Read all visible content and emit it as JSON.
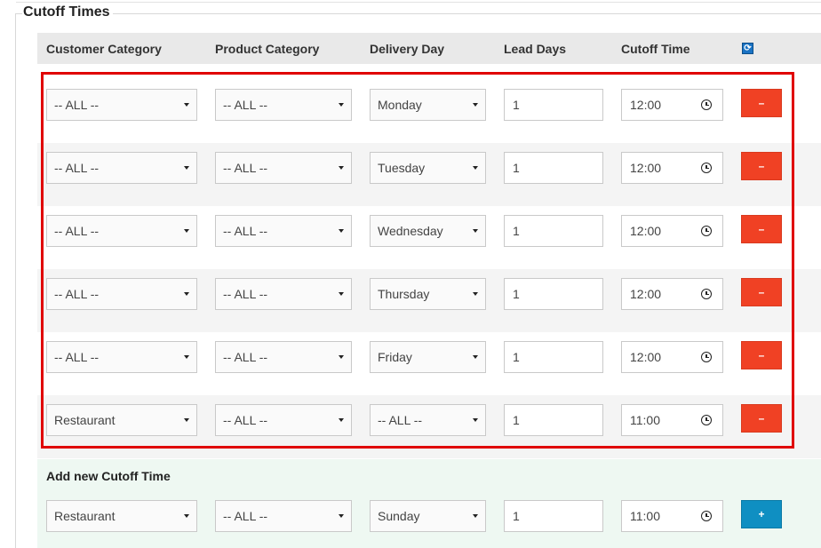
{
  "legend": "Cutoff Times",
  "headers": {
    "customer_category": "Customer Category",
    "product_category": "Product Category",
    "delivery_day": "Delivery Day",
    "lead_days": "Lead Days",
    "cutoff_time": "Cutoff Time"
  },
  "refresh_icon": "refresh-icon",
  "rows": [
    {
      "customer": "-- ALL --",
      "product": "-- ALL --",
      "day": "Monday",
      "lead": "1",
      "time": "12:00",
      "button": "–"
    },
    {
      "customer": "-- ALL --",
      "product": "-- ALL --",
      "day": "Tuesday",
      "lead": "1",
      "time": "12:00",
      "button": "–"
    },
    {
      "customer": "-- ALL --",
      "product": "-- ALL --",
      "day": "Wednesday",
      "lead": "1",
      "time": "12:00",
      "button": "–"
    },
    {
      "customer": "-- ALL --",
      "product": "-- ALL --",
      "day": "Thursday",
      "lead": "1",
      "time": "12:00",
      "button": "–"
    },
    {
      "customer": "-- ALL --",
      "product": "-- ALL --",
      "day": "Friday",
      "lead": "1",
      "time": "12:00",
      "button": "–"
    },
    {
      "customer": "Restaurant",
      "product": "-- ALL --",
      "day": "-- ALL --",
      "lead": "1",
      "time": "11:00",
      "button": "–"
    }
  ],
  "add_new": {
    "title": "Add new Cutoff Time",
    "customer": "Restaurant",
    "product": "-- ALL --",
    "day": "Sunday",
    "lead": "1",
    "time": "11:00",
    "button": "+"
  },
  "colors": {
    "highlight_border": "#e00000",
    "delete_button": "#f04124",
    "add_button": "#0f8fc2",
    "add_panel_bg": "#eef8f2"
  }
}
